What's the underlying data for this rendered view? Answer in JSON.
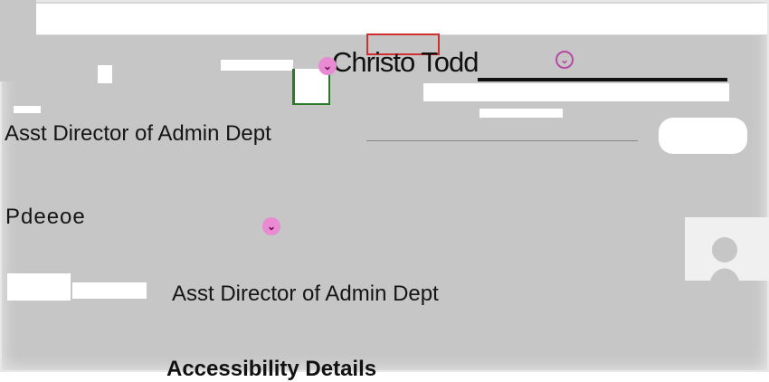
{
  "header": {
    "person_name": "Christo Todd",
    "dropdown_symbol": "⌄"
  },
  "rows": [
    {
      "title": "Asst Director of Admin Dept"
    },
    {
      "name": "Pdeeoe",
      "title": "Asst Director of Admin Dept"
    }
  ],
  "footer": {
    "text": "Accessibility Details"
  },
  "colors": {
    "accent": "#e98ad2",
    "panel": "#c6c6c6"
  }
}
